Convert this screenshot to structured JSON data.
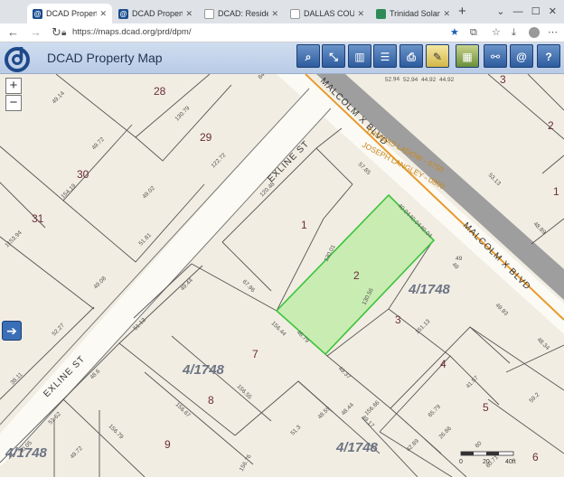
{
  "browser": {
    "tabs": [
      {
        "label": "DCAD Property Ma",
        "icon": "dcad-icon",
        "active": true
      },
      {
        "label": "DCAD Property Ma",
        "icon": "dcad-icon",
        "active": false
      },
      {
        "label": "DCAD: Residentia",
        "icon": "page-icon",
        "active": false
      },
      {
        "label": "DALLAS COUNTY,",
        "icon": "page-icon",
        "active": false
      },
      {
        "label": "Trinidad Solano -",
        "icon": "tree-icon",
        "active": false
      }
    ],
    "url": "https://maps.dcad.org/prd/dpm/"
  },
  "app": {
    "title": "DCAD Property Map",
    "tools": [
      "zoom-tool",
      "select-tool",
      "layers-tool",
      "list-tool",
      "print-tool",
      "notes-tool",
      "map-tool",
      "share-tool",
      "email-tool",
      "help-tool"
    ]
  },
  "map": {
    "zoom_in": "+",
    "zoom_out": "−",
    "side_arrow": "➔",
    "streets": [
      {
        "name": "EXLINE ST",
        "rot": -45
      },
      {
        "name": "EXLINE ST",
        "rot": -45
      },
      {
        "name": "MALCOLM X BLVD",
        "rot": 45
      },
      {
        "name": "MALCOLM X BLVD",
        "rot": 45
      },
      {
        "name": "THOMAS LADOW - 0750",
        "rot": 28
      },
      {
        "name": "JOSEPH LANGLEY - 0800",
        "rot": 28
      }
    ],
    "lot_numbers": [
      "28",
      "29",
      "30",
      "31",
      "1",
      "2",
      "3",
      "4",
      "5",
      "6",
      "7",
      "8",
      "9",
      "3",
      "2",
      "1"
    ],
    "block_labels": [
      "4/1748",
      "4/1748",
      "4/1748",
      "4/1748"
    ],
    "dimensions": [
      "52.94",
      "52.94",
      "44.92",
      "44.92",
      "130.79",
      "84",
      "49.14",
      "49.72",
      "122.72",
      "49.02",
      "154.19",
      "51.81",
      "1153.94",
      "52.27",
      "49.08",
      "49",
      "57.85",
      "120.48",
      "130.01",
      "40.04",
      "40.04",
      "40.04",
      "49",
      "53.13",
      "48.89",
      "49.93",
      "48.34",
      "49.44",
      "67.96",
      "51.13",
      "156.44",
      "46.79",
      "130.56",
      "151.13",
      "41.57",
      "59.2",
      "65.79",
      "60",
      "60.71",
      "49.17",
      "156.55",
      "156.67",
      "49.37",
      "38.11",
      "48.6",
      "51.62",
      "156.79",
      "48.59",
      "48.44",
      "156.66",
      "51.3",
      "156.76",
      "42.89",
      "26.86",
      "40.05",
      "49.72"
    ],
    "scale": {
      "values": [
        "0",
        "20",
        "40ft"
      ]
    }
  }
}
